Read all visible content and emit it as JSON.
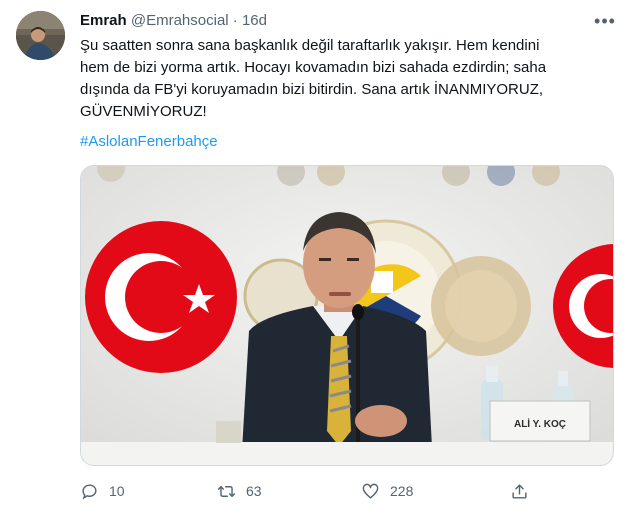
{
  "tweet": {
    "author_name": "Emrah",
    "author_handle": "@Emrahsocial",
    "separator": "·",
    "time": "16d",
    "text_lines": [
      "Şu saatten sonra sana başkanlık değil taraftarlık yakışır. Hem kendini",
      "hem de bizi yorma artık. Hocayı kovamadın bizi sahada ezdirdin; saha",
      "dışında da FB'yi koruyamadın bizi bitirdin. Sana artık İNANMIYORUZ,",
      "GÜVENMİYORUZ!"
    ],
    "hashtag": "#AslolanFenerbahçe",
    "more_label": "•••",
    "nameplate": "ALİ Y. KOÇ",
    "stats": {
      "replies": "10",
      "retweets": "63",
      "likes": "228"
    }
  },
  "icons": {
    "more": "more-icon",
    "reply": "reply-icon",
    "retweet": "retweet-icon",
    "like": "heart-icon",
    "share": "share-icon"
  },
  "colors": {
    "accent": "#1d9bf0",
    "secondary_text": "#536471",
    "primary_text": "#0f1419",
    "border": "#cfd9de",
    "flag_red": "#e30a17"
  }
}
